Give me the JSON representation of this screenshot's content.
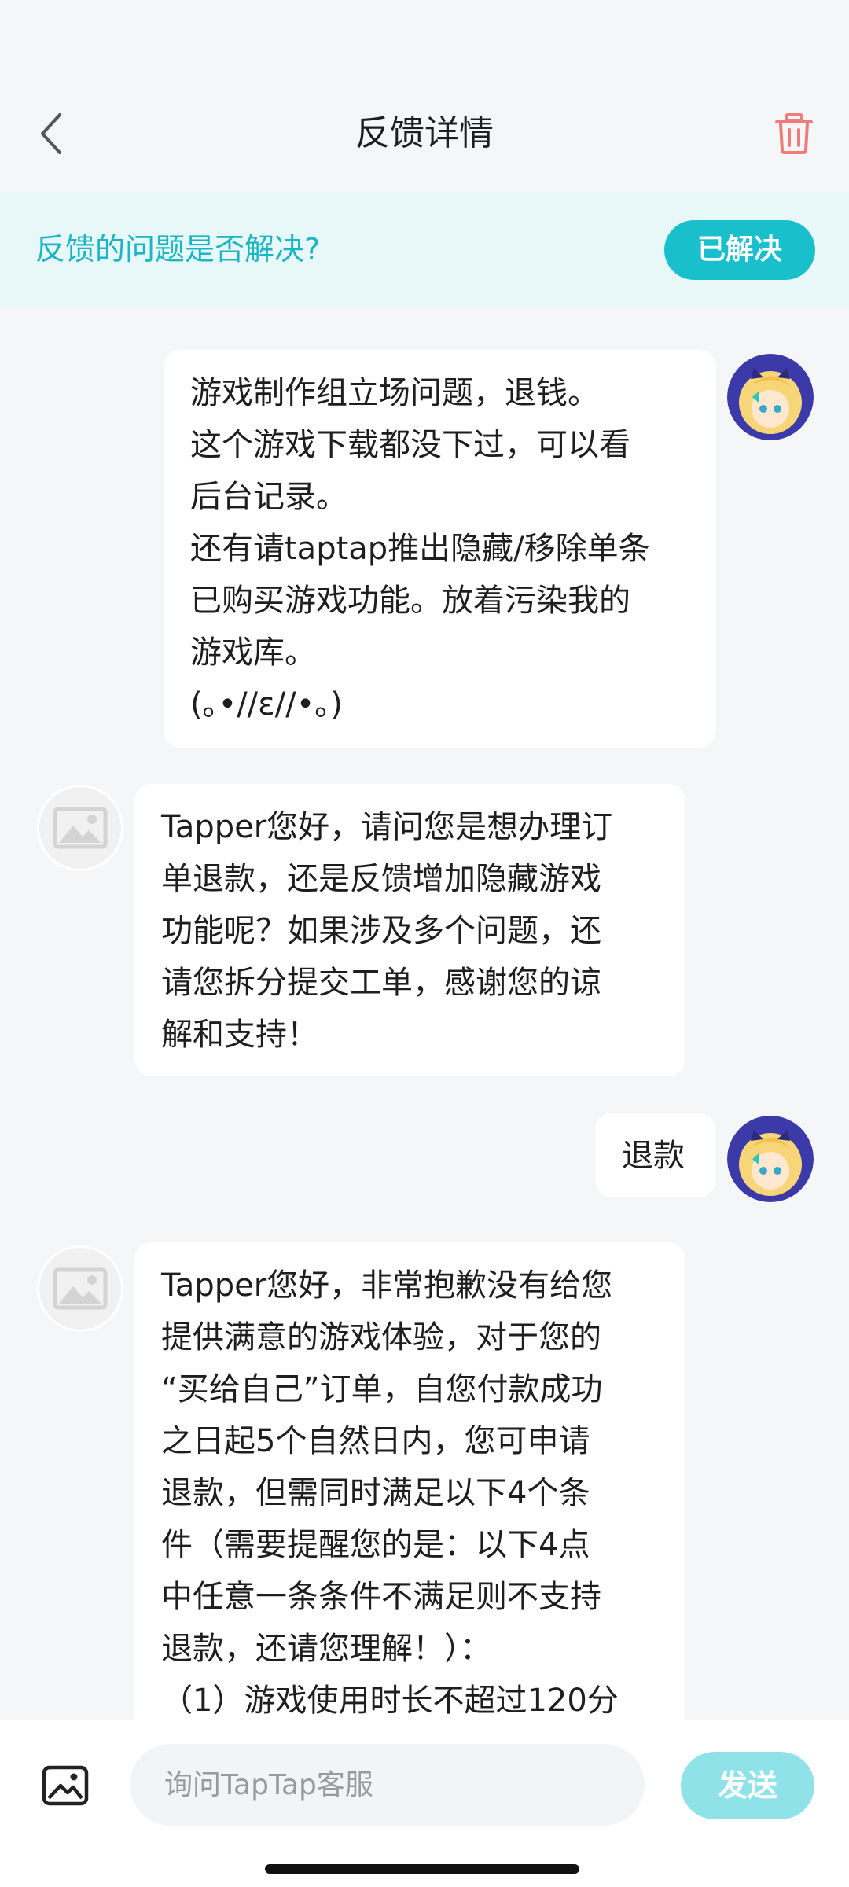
{
  "header": {
    "title": "反馈详情"
  },
  "banner": {
    "question": "反馈的问题是否解决?",
    "resolved_label": "已解决"
  },
  "messages": [
    {
      "sender": "user",
      "text": "游戏制作组立场问题，退钱。\n这个游戏下载都没下过，可以看\n后台记录。\n还有请taptap推出隐藏/移除单条\n已购买游戏功能。放着污染我的\n游戏库。\n(｡•//ε//•｡)"
    },
    {
      "sender": "agent",
      "text": "Tapper您好，请问您是想办理订\n单退款，还是反馈增加隐藏游戏\n功能呢？如果涉及多个问题，还\n请您拆分提交工单，感谢您的谅\n解和支持！"
    },
    {
      "sender": "user",
      "text": "退款"
    },
    {
      "sender": "agent",
      "text": "Tapper您好，非常抱歉没有给您\n提供满意的游戏体验，对于您的\n“买给自己”订单，自您付款成功\n之日起5个自然日内，您可申请\n退款，但需同时满足以下4个条\n件（需要提醒您的是：以下4点\n中任意一条条件不满足则不支持\n退款，还请您理解！）：\n（1）游戏使用时长不超过120分"
    }
  ],
  "input": {
    "placeholder": "询问TapTap客服",
    "send_label": "发送"
  },
  "colors": {
    "accent": "#19c0cc",
    "banner_bg": "#e8f8f9",
    "delete_icon": "#f07b7b",
    "send_disabled": "#8fe2e8"
  },
  "icons": {
    "back": "chevron-left-icon",
    "delete": "trash-icon",
    "image": "image-icon",
    "agent_avatar": "image-placeholder-icon"
  }
}
